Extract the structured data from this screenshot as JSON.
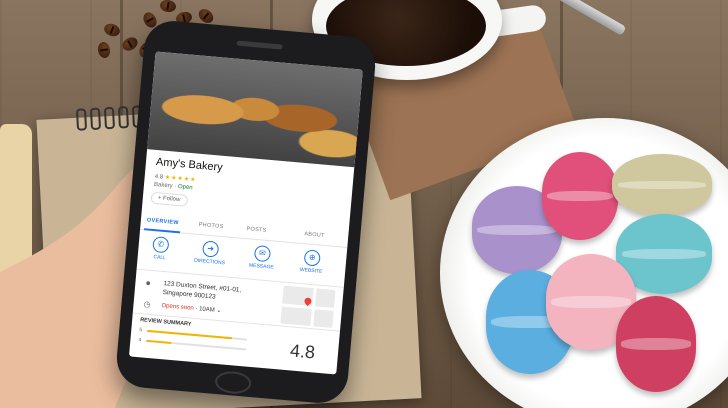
{
  "listing": {
    "name": "Amy's Bakery",
    "rating": "4.8",
    "stars": "★★★★★",
    "category": "Bakery",
    "separator": " · ",
    "status": "Open",
    "follow_label": "+ Follow"
  },
  "tabs": [
    "OVERVIEW",
    "PHOTOS",
    "POSTS",
    "ABOUT"
  ],
  "actions": [
    {
      "label": "CALL",
      "icon": "phone-icon",
      "glyph": "✆"
    },
    {
      "label": "DIRECTIONS",
      "icon": "directions-icon",
      "glyph": "➜"
    },
    {
      "label": "MESSAGE",
      "icon": "message-icon",
      "glyph": "✉"
    },
    {
      "label": "WEBSITE",
      "icon": "globe-icon",
      "glyph": "⊕"
    }
  ],
  "address": {
    "line1": "123 Duxton Street, #01-01,",
    "line2": "Singapore 900123"
  },
  "hours": {
    "status": "Opens soon",
    "time": " · 10AM",
    "chevron": "⌄"
  },
  "review_summary": {
    "title": "REVIEW SUMMARY",
    "bars": [
      {
        "stars": "5",
        "fraction": 0.85
      },
      {
        "stars": "4",
        "fraction": 0.25
      }
    ],
    "average": "4.8"
  },
  "colors": {
    "accent": "#1a73e8",
    "stars": "#f4b400",
    "open": "#188038",
    "closed": "#d93025"
  }
}
